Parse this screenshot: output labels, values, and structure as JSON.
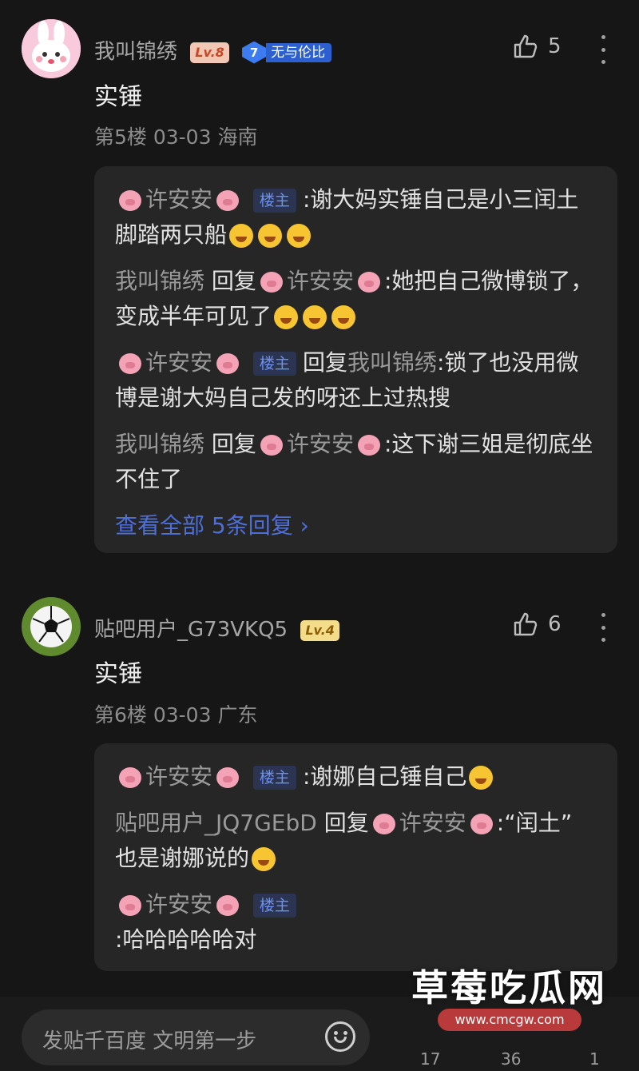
{
  "posts": [
    {
      "username": "我叫锦绣",
      "level": "Lv.8",
      "badge": {
        "number": "7",
        "text": "无与伦比"
      },
      "likes": "5",
      "content": "实锤",
      "meta": "第5楼 03-03 海南",
      "replies": [
        {
          "name": "许安安",
          "louzhu": "楼主",
          "text": ":谢大妈实锤自己是小三闰土脚踏两只船"
        },
        {
          "name": "我叫锦绣",
          "reply_word": "回复",
          "target": "许安安",
          "text": ":她把自己微博锁了，变成半年可见了"
        },
        {
          "name": "许安安",
          "louzhu": "楼主",
          "reply_word": "回复",
          "target": "我叫锦绣",
          "text": ":锁了也没用微博是谢大妈自己发的呀还上过热搜"
        },
        {
          "name": "我叫锦绣",
          "reply_word": "回复",
          "target": "许安安",
          "text": ":这下谢三姐是彻底坐不住了"
        }
      ],
      "view_all": "查看全部 5条回复 ›"
    },
    {
      "username": "贴吧用户_G73VKQ5",
      "level": "Lv.4",
      "likes": "6",
      "content": "实锤",
      "meta": "第6楼 03-03 广东",
      "replies": [
        {
          "name": "许安安",
          "louzhu": "楼主",
          "text": ":谢娜自己锤自己"
        },
        {
          "name": "贴吧用户_JQ7GEbD",
          "reply_word": "回复",
          "target": "许安安",
          "text": ":“闰土” 也是谢娜说的"
        },
        {
          "name": "许安安",
          "louzhu": "楼主",
          "text": ":哈哈哈哈哈对"
        }
      ]
    }
  ],
  "bottom_bar": {
    "placeholder": "发贴千百度 文明第一步",
    "counts": [
      "17",
      "36",
      "1"
    ]
  },
  "watermark": {
    "title": "草莓吃瓜网",
    "url": "www.cmcgw.com"
  },
  "icons": [
    "thumb-up-icon",
    "more-dots-icon",
    "pig-emoji-icon",
    "laugh-emoji-icon",
    "smile-icon"
  ]
}
